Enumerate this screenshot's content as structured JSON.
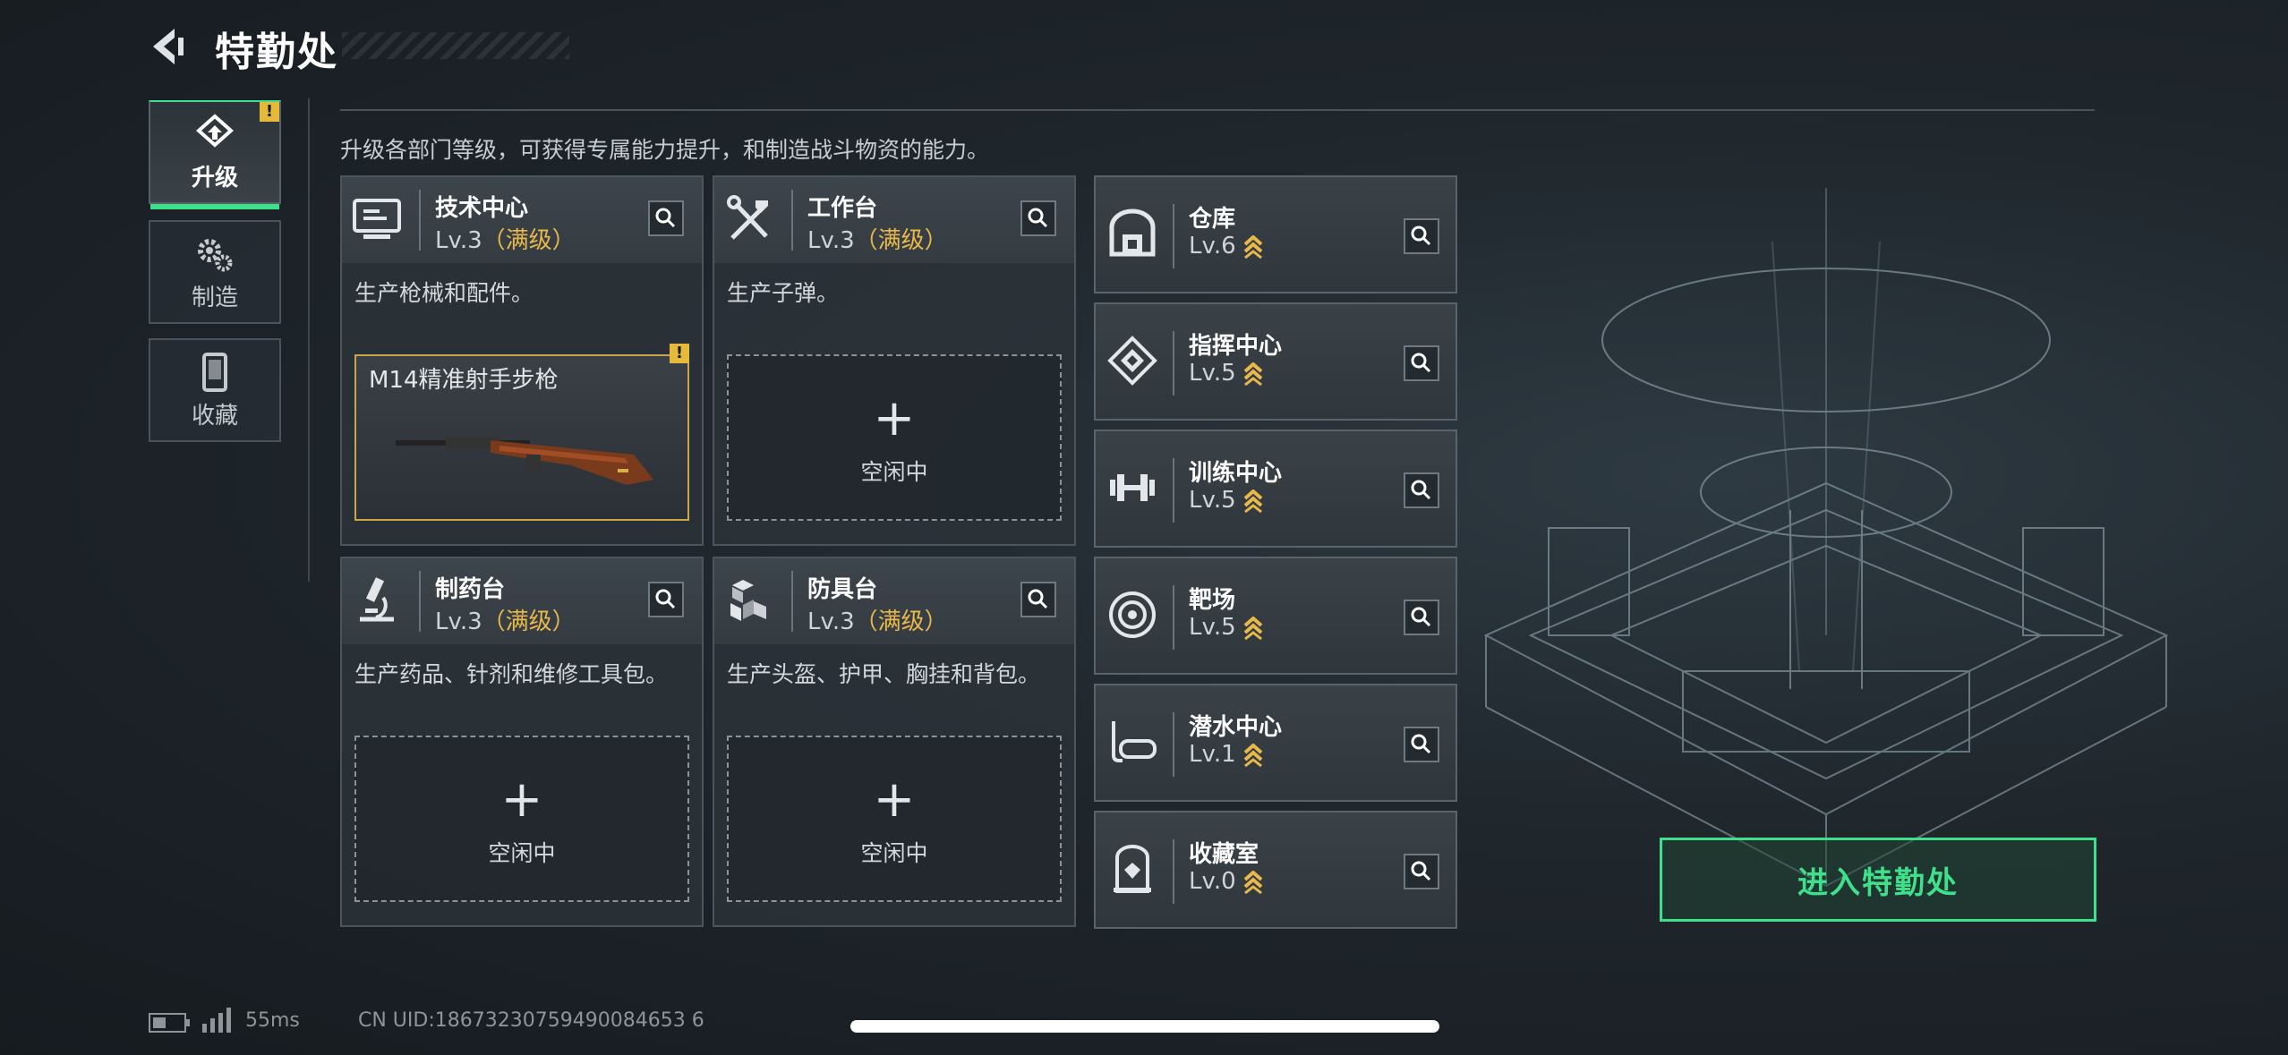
{
  "header": {
    "title": "特勤处"
  },
  "tabs": [
    {
      "label": "升级",
      "icon": "upgrade-icon",
      "badge": "!"
    },
    {
      "label": "制造",
      "icon": "gears-icon"
    },
    {
      "label": "收藏",
      "icon": "collection-icon"
    }
  ],
  "subtitle": "升级各部门等级，可获得专属能力提升，和制造战斗物资的能力。",
  "workshops": [
    {
      "name": "技术中心",
      "level": "Lv.3",
      "max_tag": "（满级）",
      "desc": "生产枪械和配件。",
      "slot_item": "M14精准射手步枪",
      "slot_badge": "!"
    },
    {
      "name": "工作台",
      "level": "Lv.3",
      "max_tag": "（满级）",
      "desc": "生产子弹。",
      "slot_text": "空闲中",
      "slot_plus": "+"
    },
    {
      "name": "制药台",
      "level": "Lv.3",
      "max_tag": "（满级）",
      "desc": "生产药品、针剂和维修工具包。",
      "slot_text": "空闲中",
      "slot_plus": "+"
    },
    {
      "name": "防具台",
      "level": "Lv.3",
      "max_tag": "（满级）",
      "desc": "生产头盔、护甲、胸挂和背包。",
      "slot_text": "空闲中",
      "slot_plus": "+"
    }
  ],
  "facilities": [
    {
      "name": "仓库",
      "level": "Lv.6",
      "icon": "warehouse-icon"
    },
    {
      "name": "指挥中心",
      "level": "Lv.5",
      "icon": "command-icon"
    },
    {
      "name": "训练中心",
      "level": "Lv.5",
      "icon": "dumbbell-icon"
    },
    {
      "name": "靶场",
      "level": "Lv.5",
      "icon": "target-icon"
    },
    {
      "name": "潜水中心",
      "level": "Lv.1",
      "icon": "diving-mask-icon"
    },
    {
      "name": "收藏室",
      "level": "Lv.0",
      "icon": "collection-icon"
    }
  ],
  "enter_button": "进入特勤处",
  "status": {
    "ping": "55ms",
    "uid": "CN UID:18673230759490084653 6"
  },
  "colors": {
    "accent": "#3fe08b",
    "gold": "#e8b84a",
    "badge": "#e5b93a"
  }
}
